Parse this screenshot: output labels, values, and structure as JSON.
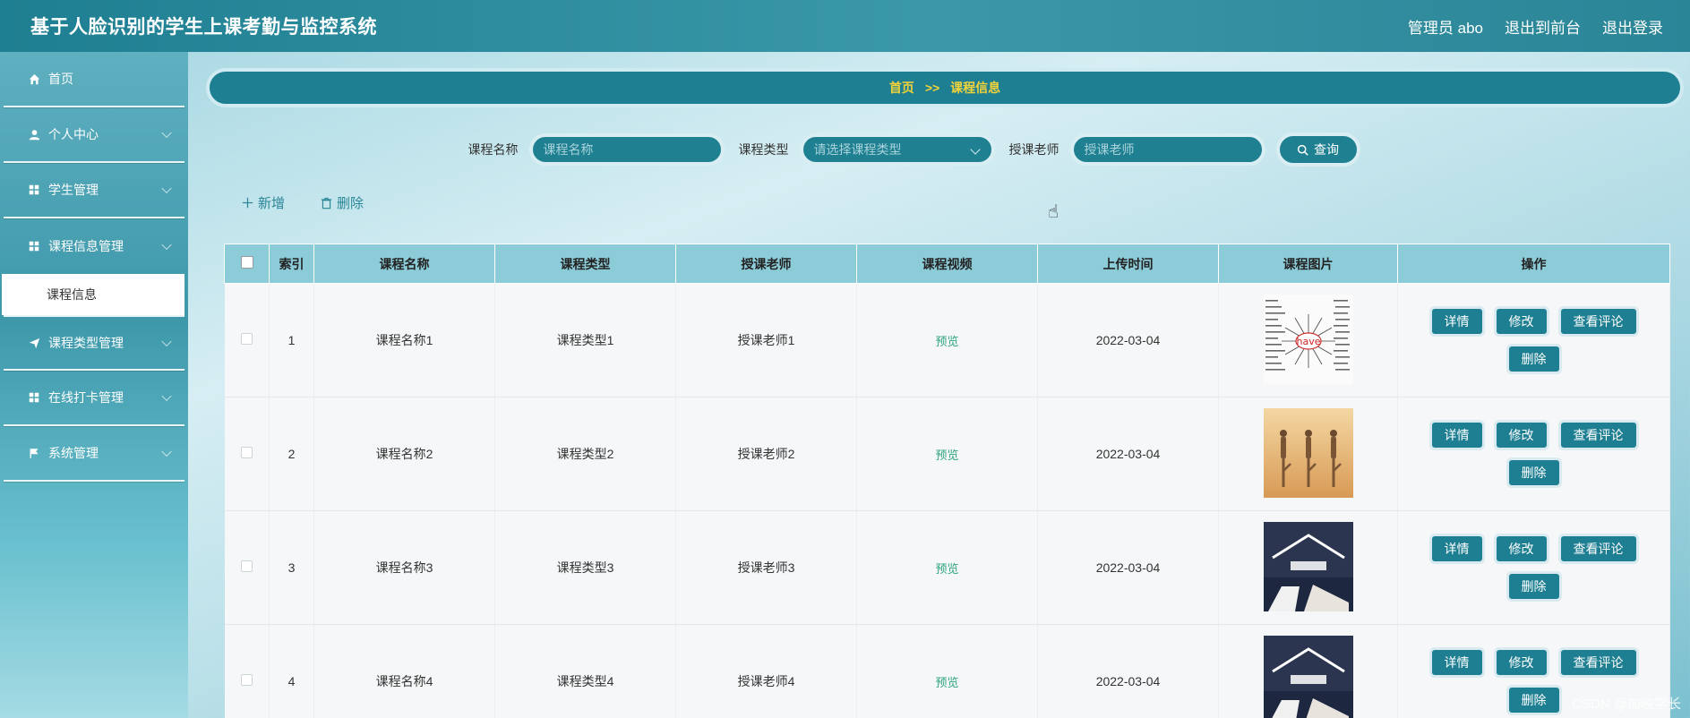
{
  "header": {
    "title": "基于人脸识别的学生上课考勤与监控系统",
    "admin_label": "管理员 abo",
    "to_front": "退出到前台",
    "logout": "退出登录"
  },
  "sidebar": {
    "items": [
      {
        "label": "首页",
        "icon": "home-icon"
      },
      {
        "label": "个人中心",
        "icon": "user-icon"
      },
      {
        "label": "学生管理",
        "icon": "grid-icon"
      },
      {
        "label": "课程信息管理",
        "icon": "grid-icon"
      },
      {
        "label": "课程类型管理",
        "icon": "send-icon"
      },
      {
        "label": "在线打卡管理",
        "icon": "grid-icon"
      },
      {
        "label": "系统管理",
        "icon": "flag-icon"
      }
    ],
    "sub_active": "课程信息"
  },
  "breadcrumb": {
    "home": "首页",
    "sep": ">>",
    "current": "课程信息"
  },
  "search": {
    "course_name_label": "课程名称",
    "course_name_placeholder": "课程名称",
    "course_type_label": "课程类型",
    "course_type_placeholder": "请选择课程类型",
    "teacher_label": "授课老师",
    "teacher_placeholder": "授课老师",
    "query_label": "查询"
  },
  "toolbar": {
    "add_label": "新增",
    "delete_label": "删除"
  },
  "table": {
    "headers": [
      "索引",
      "课程名称",
      "课程类型",
      "授课老师",
      "课程视频",
      "上传时间",
      "课程图片",
      "操作"
    ],
    "rows": [
      {
        "index": "1",
        "name": "课程名称1",
        "type": "课程类型1",
        "teacher": "授课老师1",
        "video": "预览",
        "time": "2022-03-04",
        "image": "mindmap"
      },
      {
        "index": "2",
        "name": "课程名称2",
        "type": "课程类型2",
        "teacher": "授课老师2",
        "video": "预览",
        "time": "2022-03-04",
        "image": "yoga"
      },
      {
        "index": "3",
        "name": "课程名称3",
        "type": "课程类型3",
        "teacher": "授课老师3",
        "video": "预览",
        "time": "2022-03-04",
        "image": "study"
      },
      {
        "index": "4",
        "name": "课程名称4",
        "type": "课程类型4",
        "teacher": "授课老师4",
        "video": "预览",
        "time": "2022-03-04",
        "image": "study"
      }
    ],
    "ops": {
      "detail": "详情",
      "edit": "修改",
      "comments": "查看评论",
      "delete": "删除"
    }
  },
  "watermark": "CSDN @加映学长",
  "colors": {
    "primary": "#1f7f92",
    "header_row": "#8cccd9",
    "accent_text": "#f3d23a",
    "preview": "#2fa57e"
  }
}
